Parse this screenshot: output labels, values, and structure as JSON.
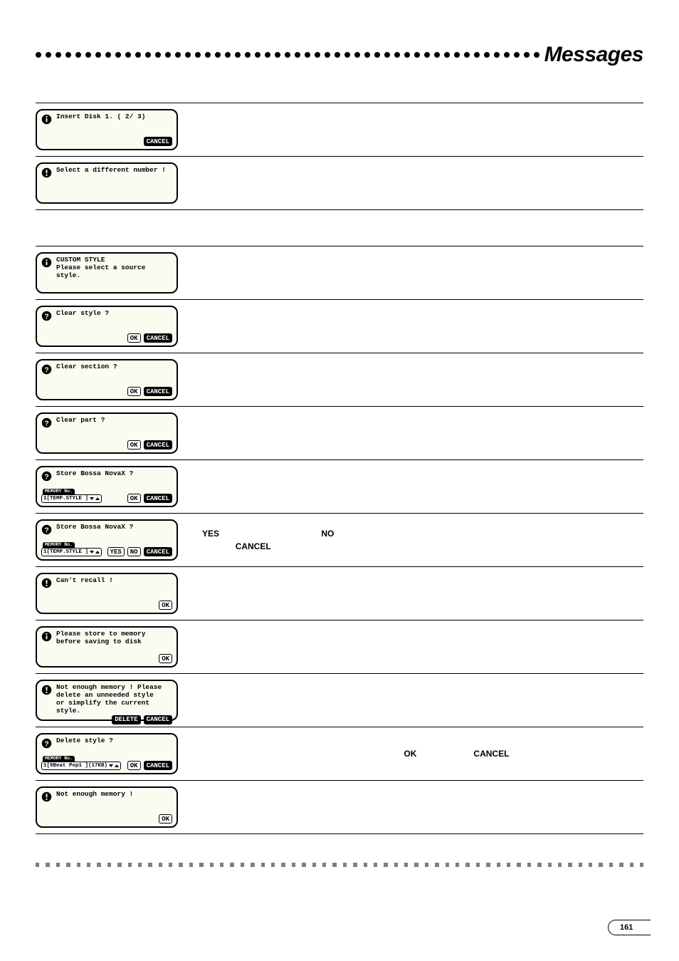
{
  "header": {
    "title": "Messages"
  },
  "icons": {
    "info": "info-icon",
    "question": "question-icon",
    "exclaim": "exclaim-icon"
  },
  "buttons": {
    "ok": "OK",
    "cancel": "CANCEL",
    "yes": "YES",
    "no": "NO",
    "delete": "DELETE"
  },
  "mem_label": "MEMORY No.",
  "rows_group1": [
    {
      "icon": "info",
      "text": "Insert Disk 1. ( 2/ 3)",
      "bottom": {
        "right": [
          {
            "t": "CANCEL",
            "hl": true
          }
        ]
      },
      "desc": ""
    },
    {
      "icon": "exclaim",
      "text": "Select a different number !",
      "bottom": null,
      "desc": ""
    }
  ],
  "rows_group2": [
    {
      "icon": "info",
      "text": "CUSTOM STYLE\nPlease select a source style.",
      "bottom": null,
      "desc": ""
    },
    {
      "icon": "question",
      "text": "Clear style ?",
      "bottom": {
        "right": [
          {
            "t": "OK"
          },
          {
            "t": "CANCEL",
            "hl": true
          }
        ]
      },
      "desc": ""
    },
    {
      "icon": "question",
      "text": "Clear section ?",
      "bottom": {
        "right": [
          {
            "t": "OK"
          },
          {
            "t": "CANCEL",
            "hl": true
          }
        ]
      },
      "desc": ""
    },
    {
      "icon": "question",
      "text": "Clear part ?",
      "bottom": {
        "right": [
          {
            "t": "OK"
          },
          {
            "t": "CANCEL",
            "hl": true
          }
        ]
      },
      "desc": ""
    },
    {
      "icon": "question",
      "text": "Store Bossa NovaX ?",
      "bottom": {
        "left_mem": {
          "body": "1[TEMP.STYLE  ]"
        },
        "right": [
          {
            "t": "OK"
          },
          {
            "t": "CANCEL",
            "hl": true
          }
        ]
      },
      "desc": ""
    },
    {
      "icon": "question",
      "text": "Store Bossa NovaX ?",
      "bottom": {
        "left_mem": {
          "body": "1[TEMP.STYLE  ]"
        },
        "right": [
          {
            "t": "YES"
          },
          {
            "t": "NO"
          },
          {
            "t": "CANCEL",
            "hl": true
          }
        ]
      },
      "desc_html": "yes_no_cancel"
    },
    {
      "icon": "exclaim",
      "text": "Can't recall !",
      "bottom": {
        "right": [
          {
            "t": "OK"
          }
        ]
      },
      "desc": ""
    },
    {
      "icon": "info",
      "text": "Please store to memory\nbefore saving to disk",
      "bottom": {
        "right": [
          {
            "t": "OK"
          }
        ]
      },
      "desc": ""
    },
    {
      "icon": "exclaim",
      "text": "Not enough memory ! Please\ndelete an unneeded style\nor simplify the current\nstyle.",
      "bottom": {
        "right": [
          {
            "t": "DELETE",
            "hl": true
          },
          {
            "t": "CANCEL",
            "hl": true
          }
        ]
      },
      "desc": ""
    },
    {
      "icon": "question",
      "text": "Delete style ?",
      "bottom": {
        "left_mem": {
          "body": "1[8Beat Pop1  ](17KB)"
        },
        "right": [
          {
            "t": "OK"
          },
          {
            "t": "CANCEL",
            "hl": true
          }
        ]
      },
      "desc_html": "ok_cancel_delete"
    },
    {
      "icon": "exclaim",
      "text": "Not enough memory !",
      "bottom": {
        "right": [
          {
            "t": "OK"
          }
        ]
      },
      "desc": ""
    }
  ],
  "desc_yes_no_cancel": {
    "yes": "YES",
    "no": "NO",
    "cancel": "CANCEL"
  },
  "desc_ok_cancel": {
    "ok": "OK",
    "cancel": "CANCEL"
  },
  "page_number": "161"
}
